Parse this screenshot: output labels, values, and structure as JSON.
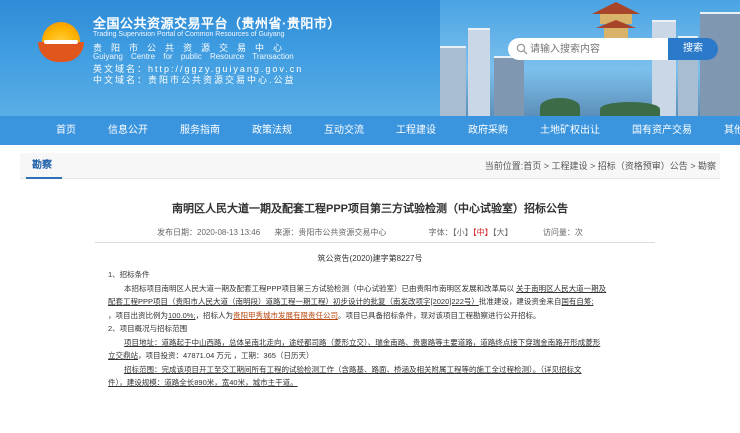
{
  "header": {
    "site_title": "全国公共资源交易平台（贵州省·贵阳市）",
    "site_title_en": "Trading Supervision Portal of Common Resources of Guiyang",
    "unit_cn": "贵阳市公共资源交易中心",
    "unit_en": "Guiyang Centre for public Resource Transaction",
    "domain_en": "英文域名：http://ggzy.guiyang.gov.cn",
    "domain_cn": "中文域名：贵阳市公共资源交易中心.公益"
  },
  "search": {
    "placeholder": "请输入搜索内容",
    "button_label": "搜索"
  },
  "nav": {
    "items": [
      {
        "label": "首页"
      },
      {
        "label": "信息公开"
      },
      {
        "label": "服务指南"
      },
      {
        "label": "政策法规"
      },
      {
        "label": "互动交流"
      },
      {
        "label": "工程建设"
      },
      {
        "label": "政府采购"
      },
      {
        "label": "土地矿权出让"
      },
      {
        "label": "国有资产交易"
      },
      {
        "label": "其他交易"
      }
    ]
  },
  "breadcrumb": {
    "section_tag": "勘察",
    "path": "当前位置:首页 > 工程建设 > 招标（资格预审）公告 > 勘察"
  },
  "article": {
    "title": "南明区人民大道一期及配套工程PPP项目第三方试验检测（中心试验室）招标公告",
    "publish_date": "发布日期：2020-08-13 13:46",
    "source": "来源：贵阳市公共资源交易中心",
    "font_label": "字体：",
    "font_small": "【小】",
    "font_medium": "【中】",
    "font_large": "【大】",
    "visits": "访问量：次",
    "doc_number": "筑公资告(2020)建字第8227号",
    "section1_heading": "1、招标条件",
    "section1_line1": "本招标项目南明区人民大道一期及配套工程PPP项目第三方试验检测（中心试验室）已由贵阳市南明区发展和改革局以",
    "section1_line1_u": "关于南明区人民大道一期及",
    "section1_line2_u": "配套工程PPP项目（贵阳市人民大道（南明段）道路工程一期工程）初步设计的批复（南发改项字[2020]222号）",
    "section1_line2": "批准建设，建设资金来自",
    "section1_line2_fund": "国有自筹;",
    "section1_line3a": "，项目出资比例为",
    "section1_line3_pct": "100.0%;",
    "section1_line3b": "，招标人为",
    "section1_line3_org": "贵阳甲秀城市发展有限责任公司",
    "section1_line3c": "。项目已具备招标条件，现对该项目工程勘察进行公开招标。",
    "section2_heading": "2、项目概况与招标范围",
    "section2_line1_u": "项目地址：道路起于中山西路，总体呈南北走向，途经都司路（菱形立交）、瑞金南路、贵惠路等主要道路，道路终点接下穿瑞金南路开形成菱形",
    "section2_line2_u": "立交鼎站",
    "section2_line2": "，项目投资：47871.04 万元 ，工期：365（日历天）",
    "section2_line3_u": "招标范围：完成该项目开工至交工期间所有工程的试验检测工作（含路基、路面、桥涵及相关附属工程等的施工全过程检测）。（详见招标文",
    "section2_line4_u": "件），建设规模：道路全长890米，宽40米，城市主干道。"
  }
}
